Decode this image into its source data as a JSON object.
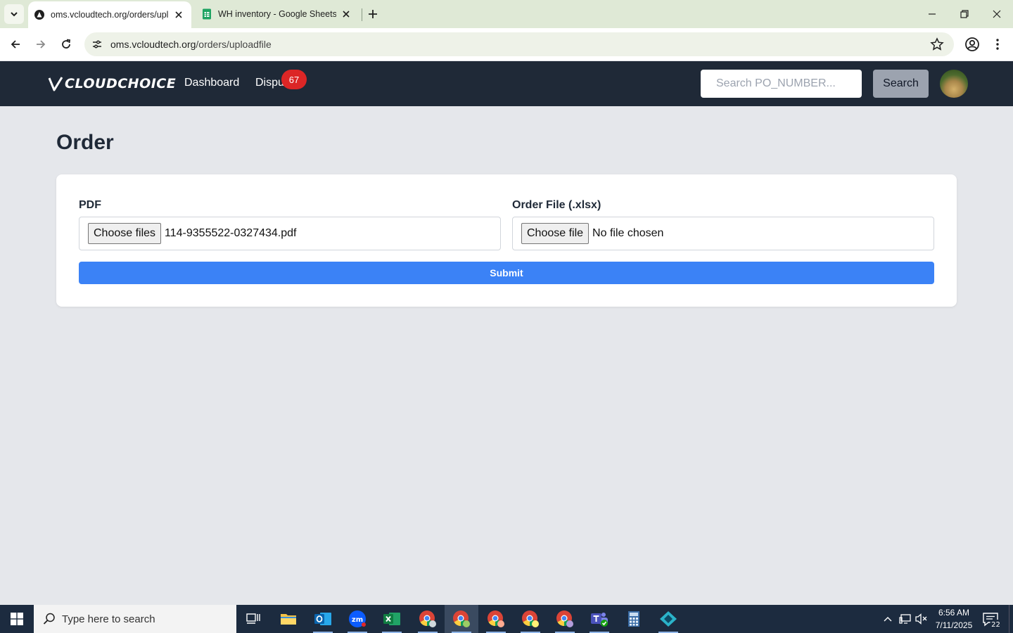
{
  "browser": {
    "tabs": [
      {
        "title": "oms.vcloudtech.org/orders/uploadfile",
        "active": true
      },
      {
        "title": "WH inventory - Google Sheets",
        "active": false
      }
    ],
    "url_host": "oms.vcloudtech.org",
    "url_path": "/orders/uploadfile"
  },
  "header": {
    "logo_text": "CLOUDCHOICE",
    "nav": {
      "dashboard": "Dashboard",
      "disputes": "Dispu"
    },
    "disputes_badge": "67",
    "search_placeholder": "Search PO_NUMBER...",
    "search_button": "Search"
  },
  "main": {
    "title": "Order",
    "pdf": {
      "label": "PDF",
      "button": "Choose files",
      "file": "114-9355522-0327434.pdf"
    },
    "order_file": {
      "label": "Order File (.xlsx)",
      "button": "Choose file",
      "file": "No file chosen"
    },
    "submit": "Submit"
  },
  "taskbar": {
    "search_placeholder": "Type here to search",
    "time": "6:56 AM",
    "date": "7/11/2025",
    "notification_count": "22",
    "apps": [
      "task-view-icon",
      "file-explorer-icon",
      "outlook-icon",
      "zoom-icon",
      "excel-icon",
      "chrome-icon",
      "chrome-icon",
      "chrome-icon",
      "chrome-icon",
      "chrome-icon",
      "teams-icon",
      "calculator-icon",
      "app-icon"
    ]
  },
  "colors": {
    "nav_bg": "#1f2937",
    "accent": "#3b82f6",
    "badge": "#dc2626",
    "page_bg": "#e5e7eb"
  }
}
